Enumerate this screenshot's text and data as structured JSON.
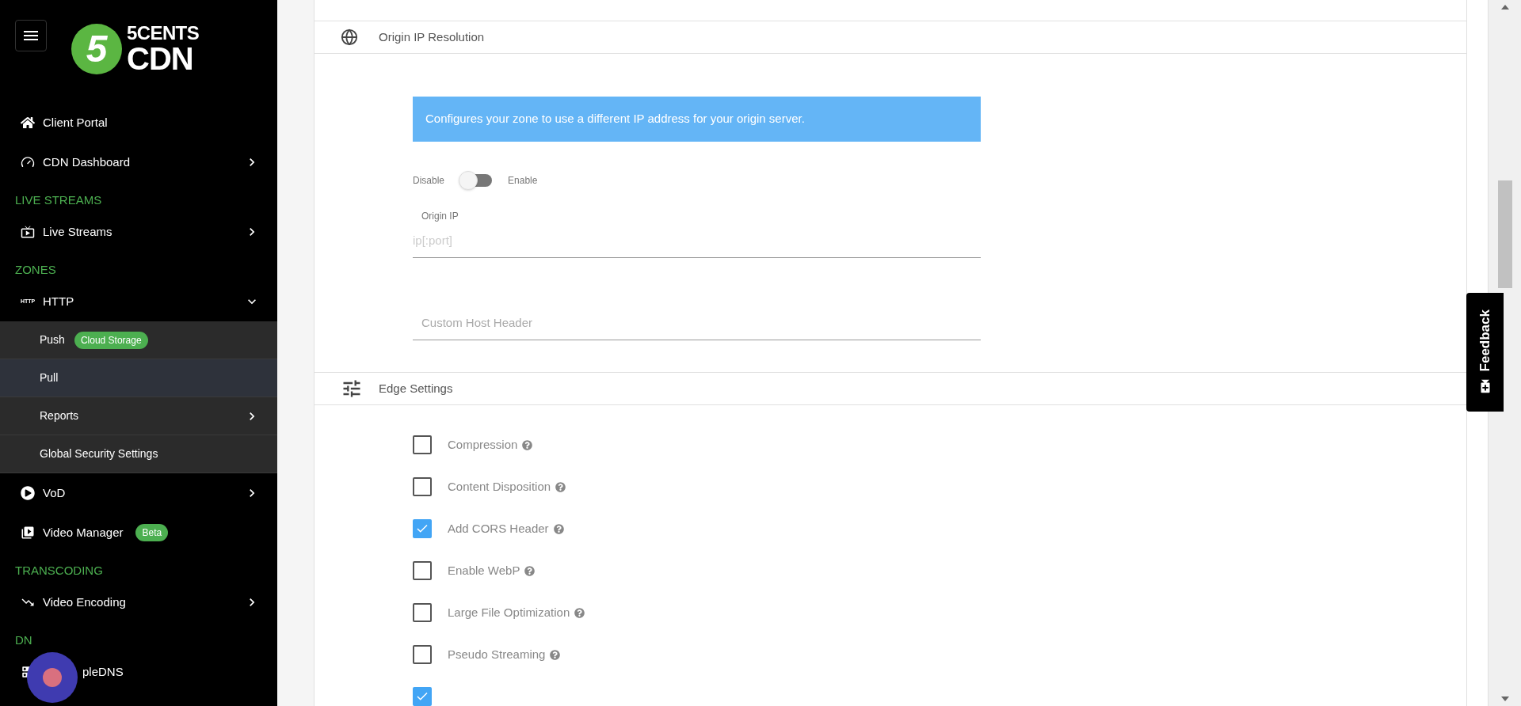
{
  "sidebar": {
    "logo": {
      "badge": "5",
      "line1": "5CENTS",
      "line2": "CDN"
    },
    "items": [
      {
        "kind": "item",
        "label": "Client Portal"
      },
      {
        "kind": "item",
        "label": "CDN Dashboard",
        "expanded": false
      },
      {
        "kind": "heading",
        "label": "LIVE STREAMS"
      },
      {
        "kind": "item",
        "label": "Live Streams",
        "expanded": false
      },
      {
        "kind": "heading",
        "label": "ZONES"
      },
      {
        "kind": "item",
        "label": "HTTP",
        "icon_text": "HTTP",
        "expanded": true,
        "children": [
          {
            "label": "Push",
            "badge": "Cloud Storage",
            "selected": false
          },
          {
            "label": "Pull",
            "selected": true
          },
          {
            "label": "Reports",
            "selected": false,
            "expanded": false
          },
          {
            "label": "Global Security Settings",
            "selected": false
          }
        ]
      },
      {
        "kind": "item",
        "label": "VoD",
        "expanded": false
      },
      {
        "kind": "item",
        "label": "Video Manager",
        "badge": "Beta"
      },
      {
        "kind": "heading",
        "label": "TRANSCODING"
      },
      {
        "kind": "item",
        "label": "Video Encoding",
        "expanded": false
      },
      {
        "kind": "heading",
        "label": "DN"
      },
      {
        "kind": "item",
        "label": "pleDNS"
      }
    ]
  },
  "origin_ip": {
    "title": "Origin IP Resolution",
    "info": "Configures your zone to use a different IP address for your origin server.",
    "toggle": {
      "off_label": "Disable",
      "on_label": "Enable",
      "on": false
    },
    "fields": [
      {
        "label": "Origin IP",
        "placeholder": "ip[:port]"
      },
      {
        "placeholder": "Custom Host Header"
      }
    ]
  },
  "edge_settings": {
    "title": "Edge Settings",
    "options": [
      {
        "label": "Compression",
        "checked": false
      },
      {
        "label": "Content Disposition",
        "checked": false
      },
      {
        "label": "Add CORS Header",
        "checked": true
      },
      {
        "label": "Enable WebP",
        "checked": false
      },
      {
        "label": "Large File Optimization",
        "checked": false
      },
      {
        "label": "Pseudo Streaming",
        "checked": false
      },
      {
        "checked": true
      }
    ]
  },
  "feedback": {
    "label": "Feedback"
  }
}
